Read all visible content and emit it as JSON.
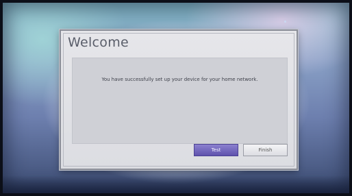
{
  "dialog": {
    "title": "Welcome",
    "message": "You have successfully set up your device for your home network.",
    "buttons": {
      "test_label": "Test",
      "finish_label": "Finish"
    }
  },
  "colors": {
    "primary_button": "#6a5fc0",
    "dialog_bg": "#e0e1e6",
    "panel_bg": "#cfd0d6"
  }
}
